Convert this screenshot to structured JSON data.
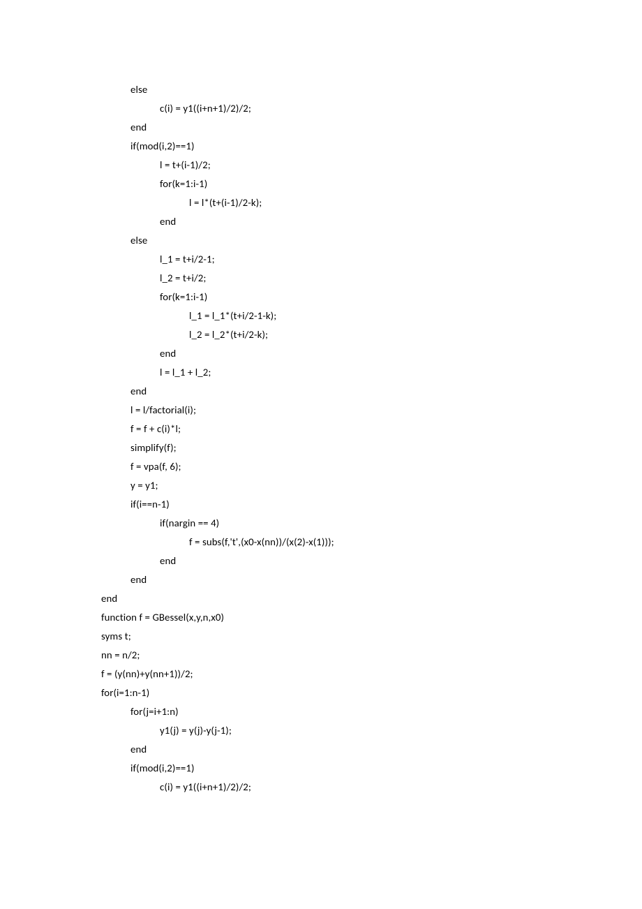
{
  "lines": [
    {
      "indent": 1,
      "text": "else"
    },
    {
      "indent": 2,
      "text": "c(i) = y1((i+n+1)/2)/2;"
    },
    {
      "indent": 1,
      "text": "end"
    },
    {
      "indent": 0,
      "text": ""
    },
    {
      "indent": 0,
      "text": ""
    },
    {
      "indent": 1,
      "text": "if(mod(i,2)==1)"
    },
    {
      "indent": 2,
      "text": "l = t+(i-1)/2;"
    },
    {
      "indent": 2,
      "text": "for(k=1:i-1)"
    },
    {
      "indent": 3,
      "text": "l = l*(t+(i-1)/2-k);"
    },
    {
      "indent": 2,
      "text": "end"
    },
    {
      "indent": 1,
      "text": "else"
    },
    {
      "indent": 2,
      "text": "l_1 = t+i/2-1;"
    },
    {
      "indent": 2,
      "text": "l_2 = t+i/2;"
    },
    {
      "indent": 2,
      "text": "for(k=1:i-1)"
    },
    {
      "indent": 3,
      "text": "l_1 = l_1*(t+i/2-1-k);"
    },
    {
      "indent": 3,
      "text": "l_2 = l_2*(t+i/2-k);"
    },
    {
      "indent": 2,
      "text": "end"
    },
    {
      "indent": 2,
      "text": "l = l_1 + l_2;"
    },
    {
      "indent": 1,
      "text": "end"
    },
    {
      "indent": 0,
      "text": ""
    },
    {
      "indent": 1,
      "text": "l = l/factorial(i);"
    },
    {
      "indent": 1,
      "text": "f = f + c(i)*l;"
    },
    {
      "indent": 1,
      "text": "simplify(f);"
    },
    {
      "indent": 1,
      "text": "f = vpa(f, 6);"
    },
    {
      "indent": 1,
      "text": "y = y1;"
    },
    {
      "indent": 0,
      "text": ""
    },
    {
      "indent": 1,
      "text": "if(i==n-1)"
    },
    {
      "indent": 2,
      "text": "if(nargin == 4)"
    },
    {
      "indent": 3,
      "text": "f = subs(f,'t',(x0-x(nn))/(x(2)-x(1)));"
    },
    {
      "indent": 2,
      "text": "end"
    },
    {
      "indent": 1,
      "text": "end"
    },
    {
      "indent": 0,
      "text": "end"
    },
    {
      "indent": 0,
      "text": ""
    },
    {
      "indent": 0,
      "text": "function f = GBessel(x,y,n,x0)"
    },
    {
      "indent": 0,
      "text": "syms t;"
    },
    {
      "indent": 0,
      "text": "nn = n/2;"
    },
    {
      "indent": 0,
      "text": "f = (y(nn)+y(nn+1))/2;"
    },
    {
      "indent": 0,
      "text": ""
    },
    {
      "indent": 0,
      "text": "for(i=1:n-1)"
    },
    {
      "indent": 1,
      "text": "for(j=i+1:n)"
    },
    {
      "indent": 2,
      "text": "y1(j) = y(j)-y(j-1);"
    },
    {
      "indent": 1,
      "text": "end"
    },
    {
      "indent": 1,
      "text": "if(mod(i,2)==1)"
    },
    {
      "indent": 2,
      "text": "c(i) = y1((i+n+1)/2)/2;"
    }
  ]
}
